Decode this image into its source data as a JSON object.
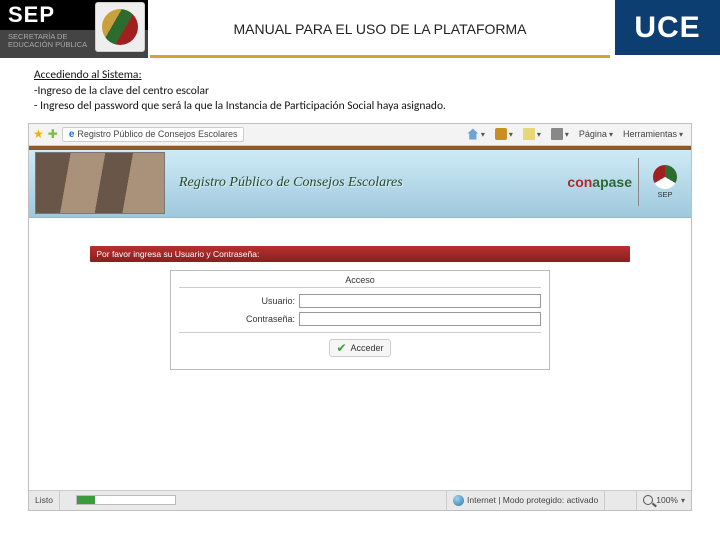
{
  "header": {
    "sep_logo": "SEP",
    "sep_sub1": "SECRETARÍA DE",
    "sep_sub2": "EDUCACIÓN PÚBLICA",
    "title": "MANUAL PARA EL USO DE LA PLATAFORMA",
    "uce": "UCE"
  },
  "instructions": {
    "heading": "Accediendo al Sistema:",
    "line1": "-Ingreso de la clave del centro escolar",
    "line2": "- Ingreso del password que será la que la Instancia de Participación Social  haya asignado."
  },
  "browser": {
    "tab_title": "Registro Público de Consejos Escolares",
    "tools_label": "Herramientas",
    "page_label": "Página",
    "banner_title": "Registro Público de Consejos Escolares",
    "conapase": "conapase",
    "mini_sep": "SEP",
    "login_prompt": "Por favor ingresa su Usuario y Contraseña:",
    "acceso": "Acceso",
    "user_label": "Usuario:",
    "pass_label": "Contraseña:",
    "submit_label": "Acceder",
    "status_ready": "Listo",
    "status_zone": "Internet | Modo protegido: activado",
    "status_zoom": "100%"
  }
}
